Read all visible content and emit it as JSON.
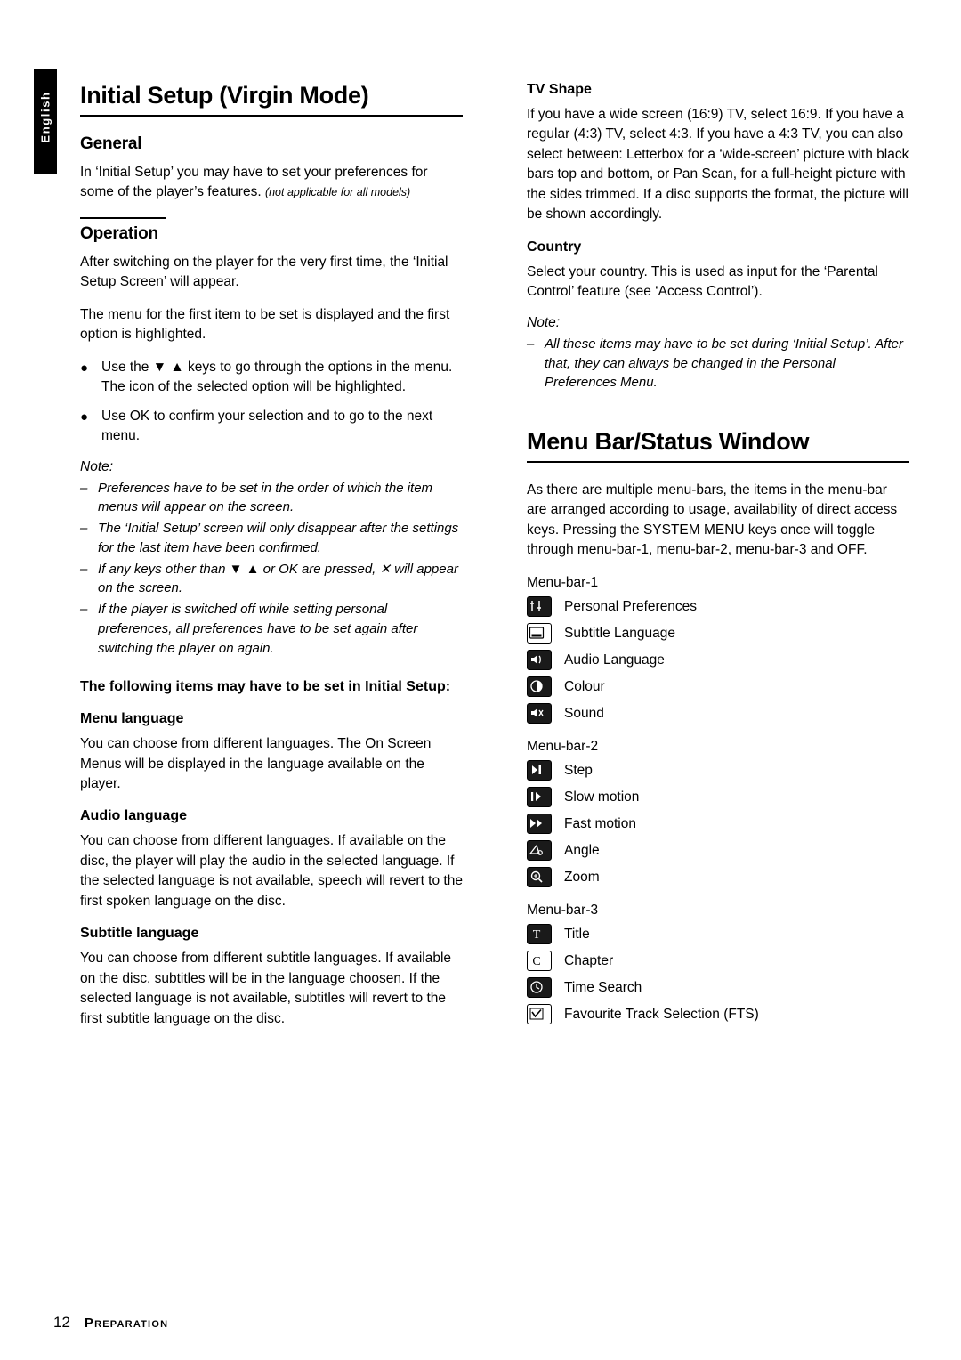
{
  "side_tab": {
    "label": "English"
  },
  "left": {
    "title": "Initial Setup (Virgin Mode)",
    "general": {
      "heading": "General",
      "p1": "In ‘Initial Setup’ you may have to set your preferences for some of the player’s features.",
      "p1_italic": "(not applicable for all models)"
    },
    "operation": {
      "heading": "Operation",
      "p1": "After switching on the player for the very first time, the ‘Initial Setup Screen’ will appear.",
      "p2": "The menu for the first item to be set is displayed and the first option is highlighted.",
      "bullets": [
        "Use the ▼ ▲ keys to go through the options in the menu. The icon of the selected option will be highlighted.",
        "Use OK to confirm your selection and to go to the next menu."
      ],
      "note_label": "Note:",
      "notes": [
        "Preferences have to be set in the order of which the item menus will appear on the screen.",
        "The ‘Initial Setup’ screen will only disappear after the settings for the last item have been confirmed.",
        "If any keys other than ▼ ▲ or OK are pressed, ✕ will appear on the screen.",
        "If the player is switched off while setting personal preferences, all preferences have to be set again after switching the player on again."
      ]
    },
    "items_intro": "The following items may have to be set in Initial Setup:",
    "menu_language": {
      "heading": "Menu language",
      "body": "You can choose from different languages. The On Screen Menus will be displayed in the language available on the player."
    },
    "audio_language": {
      "heading": "Audio language",
      "body": "You can choose from different languages. If available on the disc, the player will play the audio in the selected language. If the selected language is not available, speech will revert to the first spoken language on the disc."
    },
    "subtitle_language": {
      "heading": "Subtitle language",
      "body": "You can choose from different subtitle languages. If available on the disc, subtitles will be in the language choosen. If the selected language is not available, subtitles will revert to the first subtitle language on the disc."
    }
  },
  "right": {
    "tv_shape": {
      "heading": "TV Shape",
      "body": "If you have a wide screen (16:9) TV, select 16:9. If you have a regular (4:3) TV, select 4:3. If you have a 4:3 TV, you can also select between: Letterbox for a ‘wide-screen’ picture with black bars top and bottom, or Pan Scan, for a full-height picture with the sides trimmed. If a disc supports the format, the picture will be shown accordingly."
    },
    "country": {
      "heading": "Country",
      "body": "Select your country. This is used as input for the ‘Parental Control’ feature (see ‘Access Control’).",
      "note_label": "Note:",
      "notes": [
        "All these items may have to be set during ‘Initial Setup’. After that, they can always be changed in the Personal Preferences Menu."
      ]
    },
    "menu_bar": {
      "title": "Menu Bar/Status Window",
      "intro": "As there are multiple menu-bars, the items in the menu-bar are arranged according to usage, availability of direct access keys. Pressing the SYSTEM MENU keys once will toggle through menu-bar-1, menu-bar-2, menu-bar-3 and OFF.",
      "groups": [
        {
          "label": "Menu-bar-1",
          "items": [
            {
              "icon": "personal-preferences-icon",
              "label": "Personal Preferences"
            },
            {
              "icon": "subtitle-language-icon",
              "label": "Subtitle Language"
            },
            {
              "icon": "audio-language-icon",
              "label": "Audio Language"
            },
            {
              "icon": "colour-icon",
              "label": "Colour"
            },
            {
              "icon": "sound-icon",
              "label": "Sound"
            }
          ]
        },
        {
          "label": "Menu-bar-2",
          "items": [
            {
              "icon": "step-icon",
              "label": "Step"
            },
            {
              "icon": "slow-motion-icon",
              "label": "Slow motion"
            },
            {
              "icon": "fast-motion-icon",
              "label": "Fast motion"
            },
            {
              "icon": "angle-icon",
              "label": "Angle"
            },
            {
              "icon": "zoom-icon",
              "label": "Zoom"
            }
          ]
        },
        {
          "label": "Menu-bar-3",
          "items": [
            {
              "icon": "title-icon",
              "label": "Title"
            },
            {
              "icon": "chapter-icon",
              "label": "Chapter"
            },
            {
              "icon": "time-search-icon",
              "label": "Time Search"
            },
            {
              "icon": "fts-icon",
              "label": "Favourite Track Selection (FTS)"
            }
          ]
        }
      ]
    }
  },
  "footer": {
    "page_number": "12",
    "section": "Preparation"
  }
}
